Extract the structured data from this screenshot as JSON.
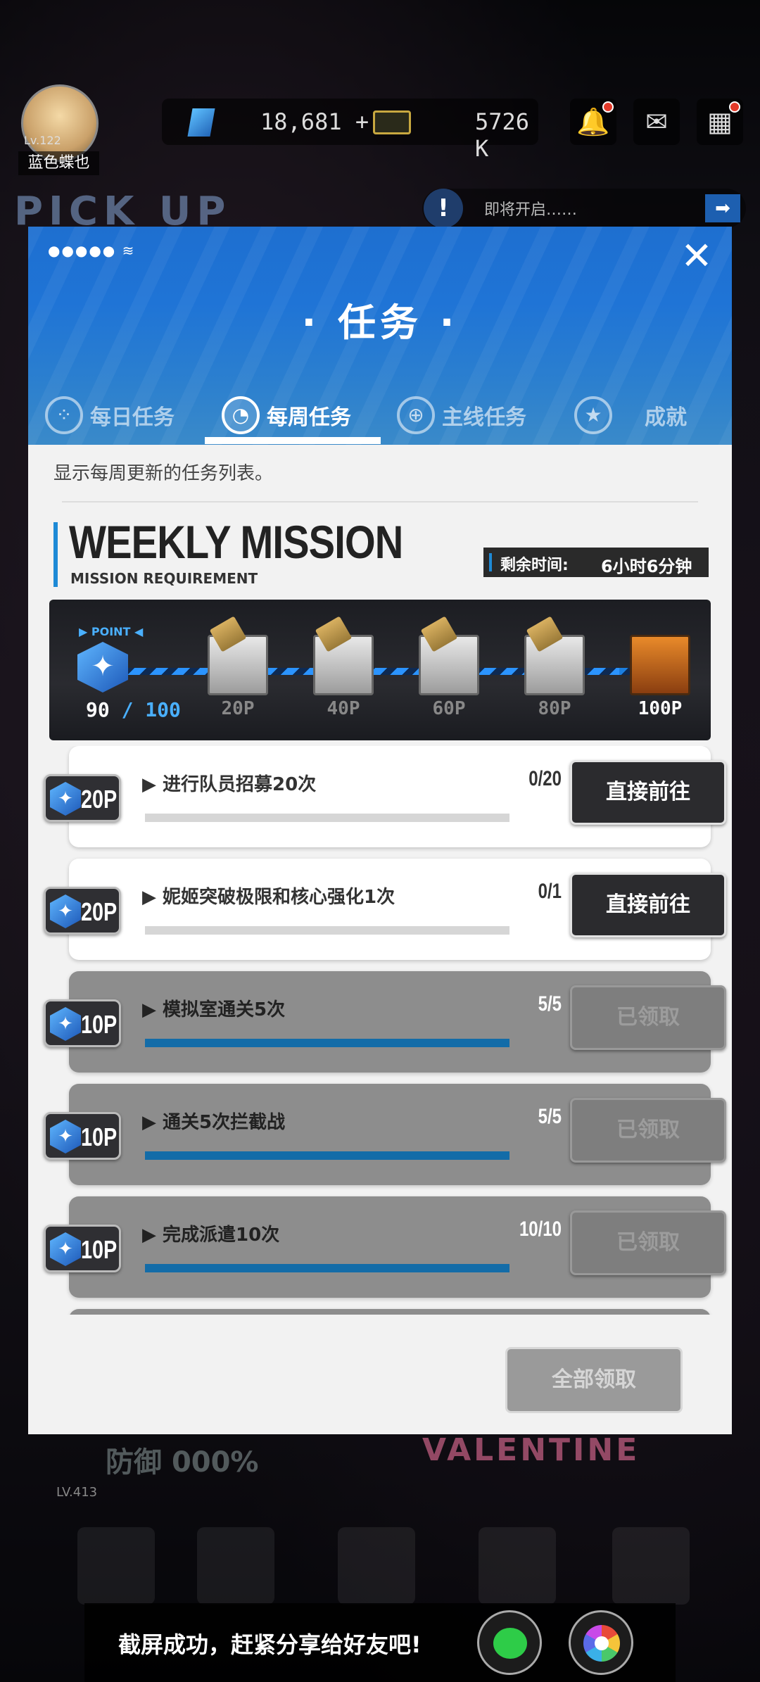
{
  "topbar": {
    "level": "Lv.122",
    "username": "蓝色蝶也",
    "gems": "18,681",
    "gems_add": "+",
    "credits": "5726 K",
    "bell_icon": "bell-icon",
    "mail_icon": "mail-icon",
    "menu_icon": "grid-menu-icon"
  },
  "background": {
    "pickup_banner": "PICK UP",
    "notice_icon": "!",
    "notice_text": "即将开启……",
    "notice_arrow": "➡",
    "valentine_banner": "VALENTINE",
    "defense_text": "防御",
    "defense_pct": "000%",
    "defense_level": "LV.413"
  },
  "dialog": {
    "status_dots": "●●●●●",
    "title": "· 任务 ·",
    "close": "✕",
    "tabs": [
      {
        "label": "每日任务",
        "icon": "⁘",
        "active": false
      },
      {
        "label": "每周任务",
        "icon": "◔",
        "active": true
      },
      {
        "label": "主线任务",
        "icon": "⊕",
        "active": false
      },
      {
        "label": "成就",
        "icon": "★",
        "active": false
      }
    ],
    "description": "显示每周更新的任务列表。",
    "weekly_title": "WEEKLY MISSION",
    "weekly_subtitle": "MISSION REQUIREMENT",
    "timer_label": "剩余时间:",
    "timer_value": "6小时6分钟"
  },
  "progress": {
    "point_label": "▶ POINT ◀",
    "current": "90",
    "separator": " / ",
    "max": "100",
    "current_value": 90,
    "max_value": 100,
    "milestones": [
      {
        "label": "20P",
        "final": false
      },
      {
        "label": "40P",
        "final": false
      },
      {
        "label": "60P",
        "final": false
      },
      {
        "label": "80P",
        "final": false
      },
      {
        "label": "100P",
        "final": true
      }
    ]
  },
  "missions": [
    {
      "points": "20P",
      "name": "▶ 进行队员招募20次",
      "count": "0/20",
      "progress": 0.0,
      "button": "直接前往",
      "claimed": false
    },
    {
      "points": "20P",
      "name": "▶ 妮姬突破极限和核心强化1次",
      "count": "0/1",
      "progress": 0.0,
      "button": "直接前往",
      "claimed": false
    },
    {
      "points": "10P",
      "name": "▶ 模拟室通关5次",
      "count": "5/5",
      "progress": 1.0,
      "button": "已领取",
      "claimed": true
    },
    {
      "points": "10P",
      "name": "▶ 通关5次拦截战",
      "count": "5/5",
      "progress": 1.0,
      "button": "已领取",
      "claimed": true
    },
    {
      "points": "10P",
      "name": "▶ 完成派遣10次",
      "count": "10/10",
      "progress": 1.0,
      "button": "已领取",
      "claimed": true
    }
  ],
  "footer": {
    "claim_all": "全部领取"
  },
  "share": {
    "text": "截屏成功，赶紧分享给好友吧!",
    "wechat_icon": "wechat-icon",
    "camera_icon": "camera-icon"
  }
}
